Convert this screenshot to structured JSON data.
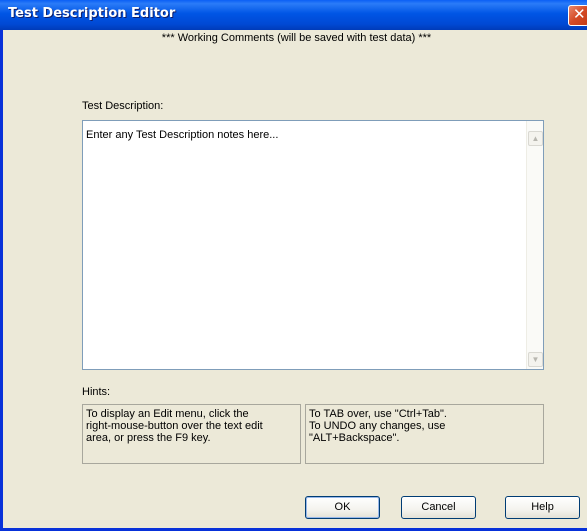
{
  "window": {
    "title": "Test Description Editor",
    "close_symbol": "✕"
  },
  "header": {
    "working_comments": "*** Working Comments (will be saved with test data) ***"
  },
  "description": {
    "label": "Test Description:",
    "text": "Enter any Test Description notes here..."
  },
  "scrollbar": {
    "up_arrow": "▲",
    "down_arrow": "▼"
  },
  "hints": {
    "label": "Hints:",
    "left": [
      "To display an Edit menu, click the",
      "right-mouse-button over the text edit",
      "area, or press the F9 key."
    ],
    "right": [
      "To TAB over, use \"Ctrl+Tab\".",
      "To UNDO any changes,  use",
      "\"ALT+Backspace\"."
    ]
  },
  "buttons": {
    "ok": "OK",
    "cancel": "Cancel",
    "help": "Help"
  }
}
